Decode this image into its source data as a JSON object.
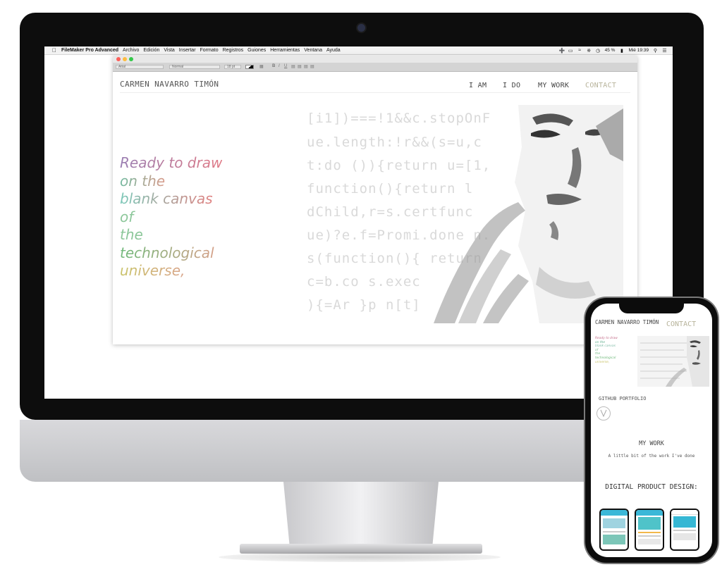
{
  "menubar": {
    "app_name": "FileMaker Pro Advanced",
    "items": [
      "Archivo",
      "Edición",
      "Vista",
      "Insertar",
      "Formato",
      "Registros",
      "Guiones",
      "Herramientas",
      "Ventana",
      "Ayuda"
    ],
    "battery": "45 %",
    "clock": "Mié 19:39"
  },
  "toolbar": {
    "font": "Arial",
    "style": "Normal",
    "size": "18 pt",
    "bold": "B",
    "italic": "I",
    "underline": "U"
  },
  "site": {
    "title": "CARMEN NAVARRO TIMÓN",
    "nav": [
      "I AM",
      "I DO",
      "MY WORK",
      "CONTACT"
    ],
    "hero_lines": [
      "Ready to draw",
      "on the",
      "blank canvas",
      "of",
      "the",
      "technological",
      "universe,"
    ],
    "hero_colors": [
      "#9a7fb3",
      "#e07a86",
      "#72b99f",
      "#d89a8a",
      "#7ac8b8",
      "#8cc79a",
      "#6fb97a",
      "#d4a088",
      "#c9c46a"
    ],
    "code_lines": [
      "[i1])===!1&&c.stopOnF",
      "ue.length:!r&&(s=u,c",
      "t:do ()){return u=[1,",
      "  function(){return l",
      "  dChild,r=s.certfunc",
      "  ue)?e.f=Promi.done n.",
      "  s(function(){ return",
      "  c=b.co     s.exec",
      "  ){=Ar    }p n[t]"
    ]
  },
  "phone": {
    "title": "CARMEN NAVARRO TIMÓN",
    "contact": "CONTACT",
    "hero_lines": [
      "Ready to draw",
      "on the",
      "blank canvas",
      "of",
      "the",
      "technological",
      "universe,"
    ],
    "github": "GITHUB PORTFOLIO",
    "mywork": "MY WORK",
    "mywork_sub": "A little bit of the work I've done",
    "digital": "DIGITAL PRODUCT DESIGN:"
  }
}
